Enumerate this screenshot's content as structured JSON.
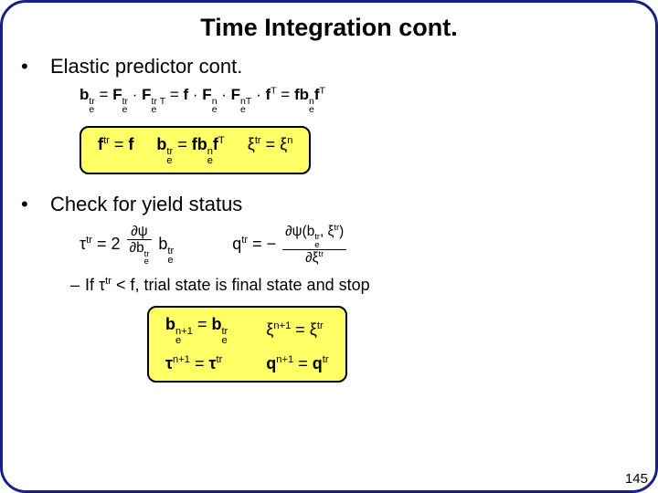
{
  "title": "Time Integration cont.",
  "sections": {
    "elastic": {
      "bullet": "Elastic predictor cont.",
      "line1": {
        "lhs_var": "b",
        "lhs_sub": "e",
        "lhs_sup": "tr",
        "eq1_a": "F",
        "eq1_a_sub": "e",
        "eq1_a_sup": "tr",
        "eq1_b": "F",
        "eq1_b_sub": "e",
        "eq1_b_sup": "tr T",
        "eq2_a": "f",
        "eq2_b": "F",
        "eq2_b_sub": "e",
        "eq2_b_sup": "n",
        "eq2_c": "F",
        "eq2_c_sub": "e",
        "eq2_c_sup": "nT",
        "eq2_d": "f",
        "eq2_d_sup": "T",
        "eq3_a": "fb",
        "eq3_a_sub": "e",
        "eq3_a_sup": "n",
        "eq3_b": "f",
        "eq3_b_sup": "T"
      },
      "yellow": {
        "e1_l": "f",
        "e1_l_sup": "tr",
        "e1_r": "f",
        "e2_l": "b",
        "e2_l_sub": "e",
        "e2_l_sup": "tr",
        "e2_r_a": "fb",
        "e2_r_a_sub": "e",
        "e2_r_a_sup": "n",
        "e2_r_b": "f",
        "e2_r_b_sup": "T",
        "e3_l": "ξ",
        "e3_l_sup": "tr",
        "e3_r": "ξ",
        "e3_r_sup": "n"
      }
    },
    "yield": {
      "bullet": "Check for yield status",
      "tau": {
        "lhs": "τ",
        "lhs_sup": "tr",
        "coeff": "2",
        "frac_num": "∂ψ",
        "frac_den_var": "b",
        "frac_den_sub": "e",
        "frac_den_sup": "tr",
        "rhs_var": "b",
        "rhs_sub": "e",
        "rhs_sup": "tr"
      },
      "q": {
        "lhs": "q",
        "lhs_sup": "tr",
        "neg": "−",
        "num_pre": "∂ψ(",
        "num_a": "b",
        "num_a_sub": "e",
        "num_a_sup": "tr",
        "num_mid": ", ",
        "num_b": "ξ",
        "num_b_sup": "tr",
        "num_post": ")",
        "den_pre": "∂",
        "den_var": "ξ",
        "den_sup": "tr"
      },
      "sub_bullet_pre": "If ",
      "sub_bullet_sym": "τ",
      "sub_bullet_sup": "tr",
      "sub_bullet_post": " < f, trial state is final state and stop",
      "final": {
        "e1_l": "b",
        "e1_l_sub": "e",
        "e1_l_sup": "n+1",
        "e1_r": "b",
        "e1_r_sub": "e",
        "e1_r_sup": "tr",
        "e2_l": "ξ",
        "e2_l_sup": "n+1",
        "e2_r": "ξ",
        "e2_r_sup": "tr",
        "e3_l": "τ",
        "e3_l_sup": "n+1",
        "e3_r": "τ",
        "e3_r_sup": "tr",
        "e4_l": "q",
        "e4_l_sup": "n+1",
        "e4_r": "q",
        "e4_r_sup": "tr"
      }
    }
  },
  "page": "145"
}
